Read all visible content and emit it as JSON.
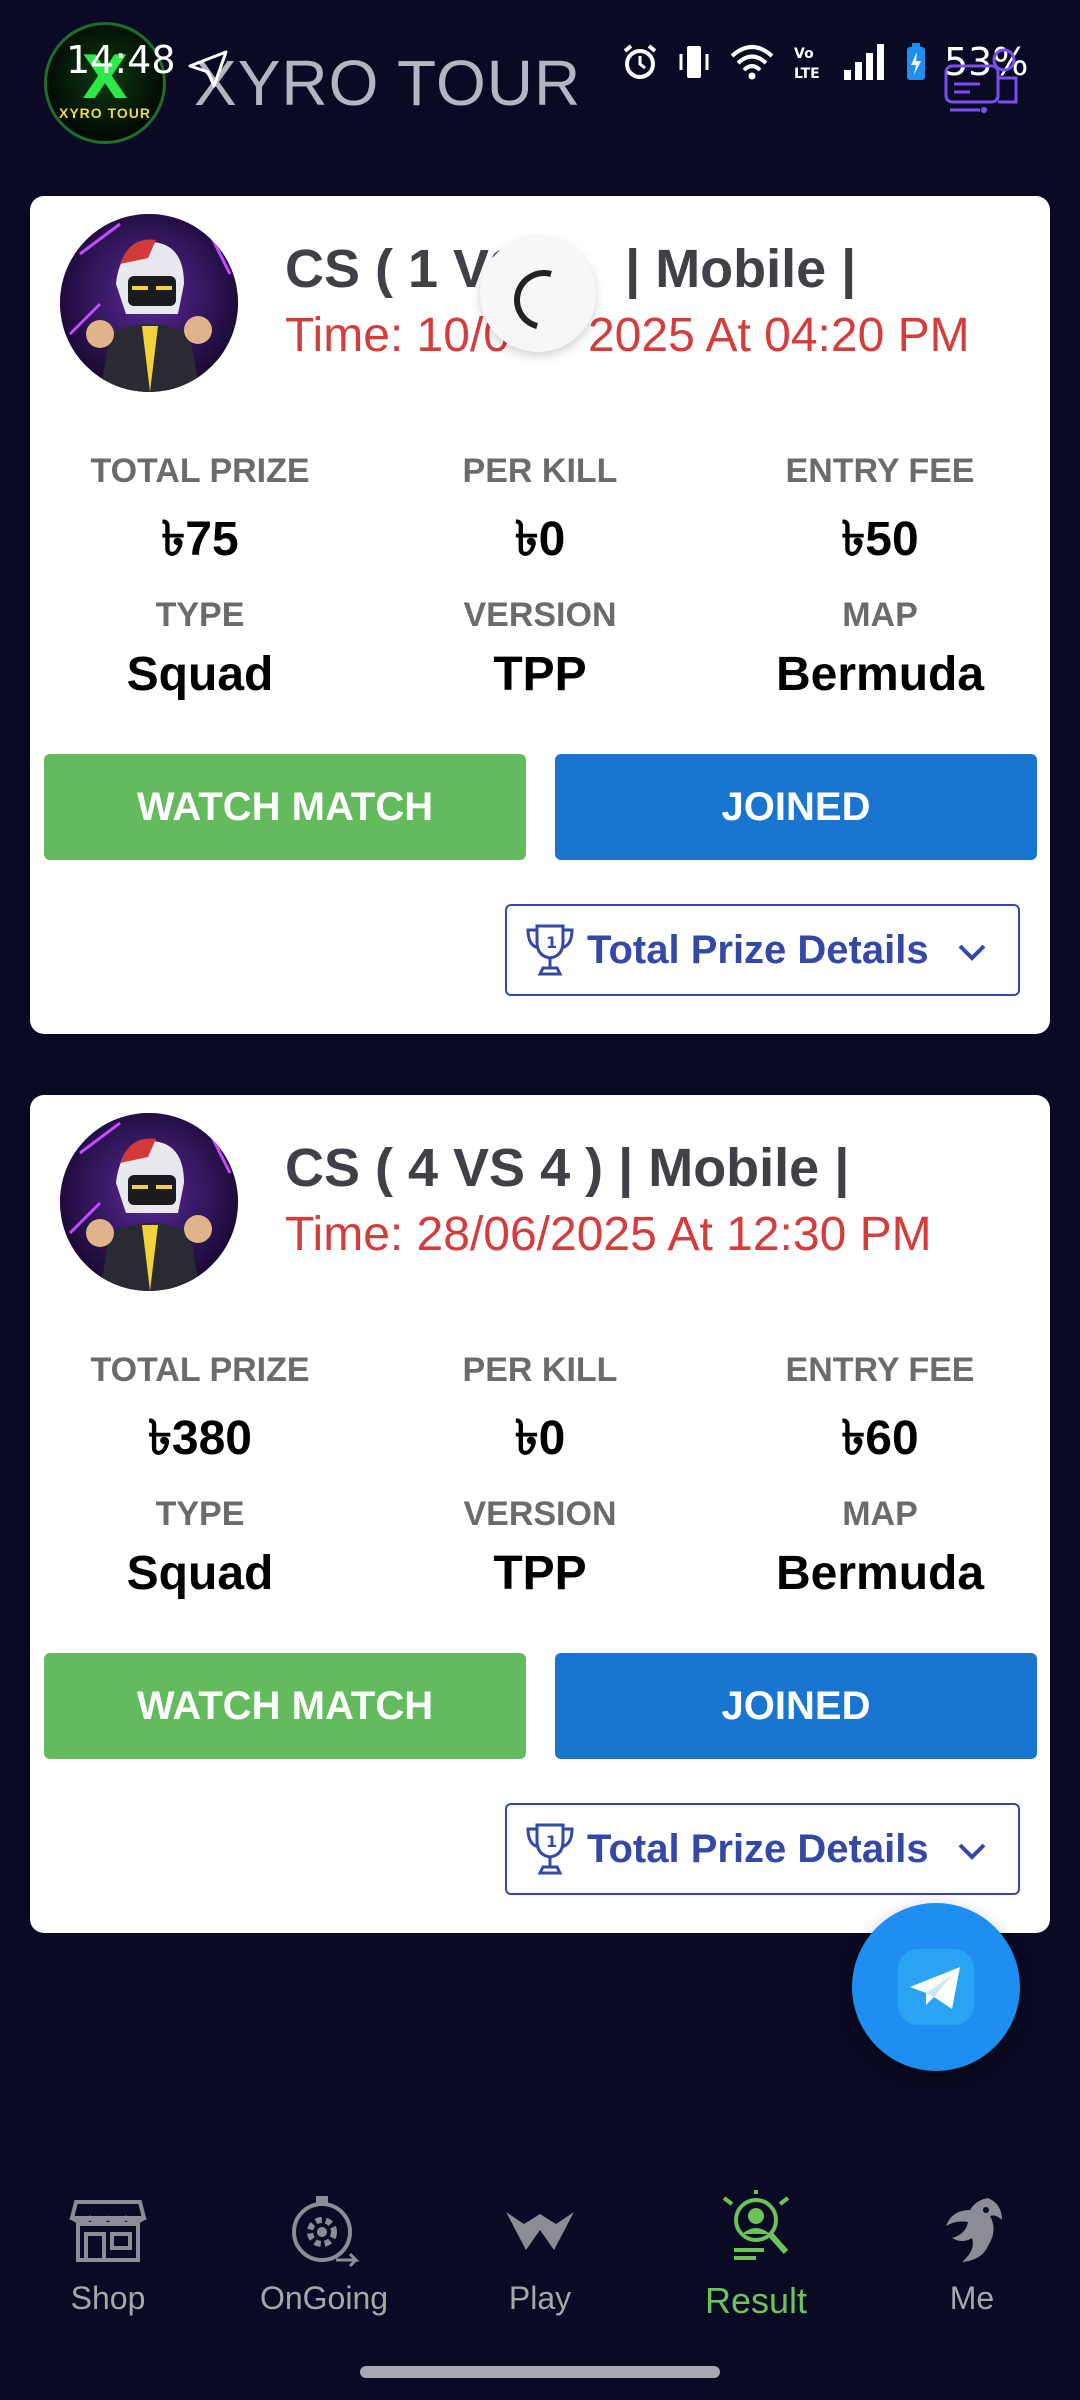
{
  "status_bar": {
    "time": "14:48",
    "battery": "53%",
    "network": "Vo LTE"
  },
  "app": {
    "title": "XYRO TOUR",
    "logo_text": "XYRO TOUR"
  },
  "labels": {
    "total_prize": "TOTAL PRIZE",
    "per_kill": "PER KILL",
    "entry_fee": "ENTRY FEE",
    "type": "TYPE",
    "version": "VERSION",
    "map": "MAP",
    "watch_match": "WATCH MATCH",
    "joined": "JOINED",
    "prize_details": "Total Prize Details"
  },
  "matches": [
    {
      "title": "CS ( 1 VS 1 ) | Mobile |",
      "title_visible": "CS ( 1 VS",
      "title_tail": "| Mobile |",
      "time": "Time: 10/06/2025 At 04:20 PM",
      "time_head": "Time: 10/0",
      "time_tail": "2025 At 04:20 PM",
      "total_prize": "৳75",
      "per_kill": "৳0",
      "entry_fee": "৳50",
      "type": "Squad",
      "version": "TPP",
      "map": "Bermuda"
    },
    {
      "title": "CS ( 4 VS 4 ) | Mobile |",
      "time": "Time: 28/06/2025 At 12:30 PM",
      "total_prize": "৳380",
      "per_kill": "৳0",
      "entry_fee": "৳60",
      "type": "Squad",
      "version": "TPP",
      "map": "Bermuda"
    }
  ],
  "nav": [
    {
      "label": "Shop",
      "icon": "shop-icon"
    },
    {
      "label": "OnGoing",
      "icon": "ongoing-icon"
    },
    {
      "label": "Play",
      "icon": "play-icon"
    },
    {
      "label": "Result",
      "icon": "result-icon",
      "active": true
    },
    {
      "label": "Me",
      "icon": "dragon-icon"
    }
  ],
  "colors": {
    "background": "#0a0a24",
    "watch_button": "#63bb5e",
    "joined_button": "#1a75d1",
    "time_text": "#d53c3c",
    "prize_details": "#3548a8",
    "active_nav": "#6bc35a"
  }
}
